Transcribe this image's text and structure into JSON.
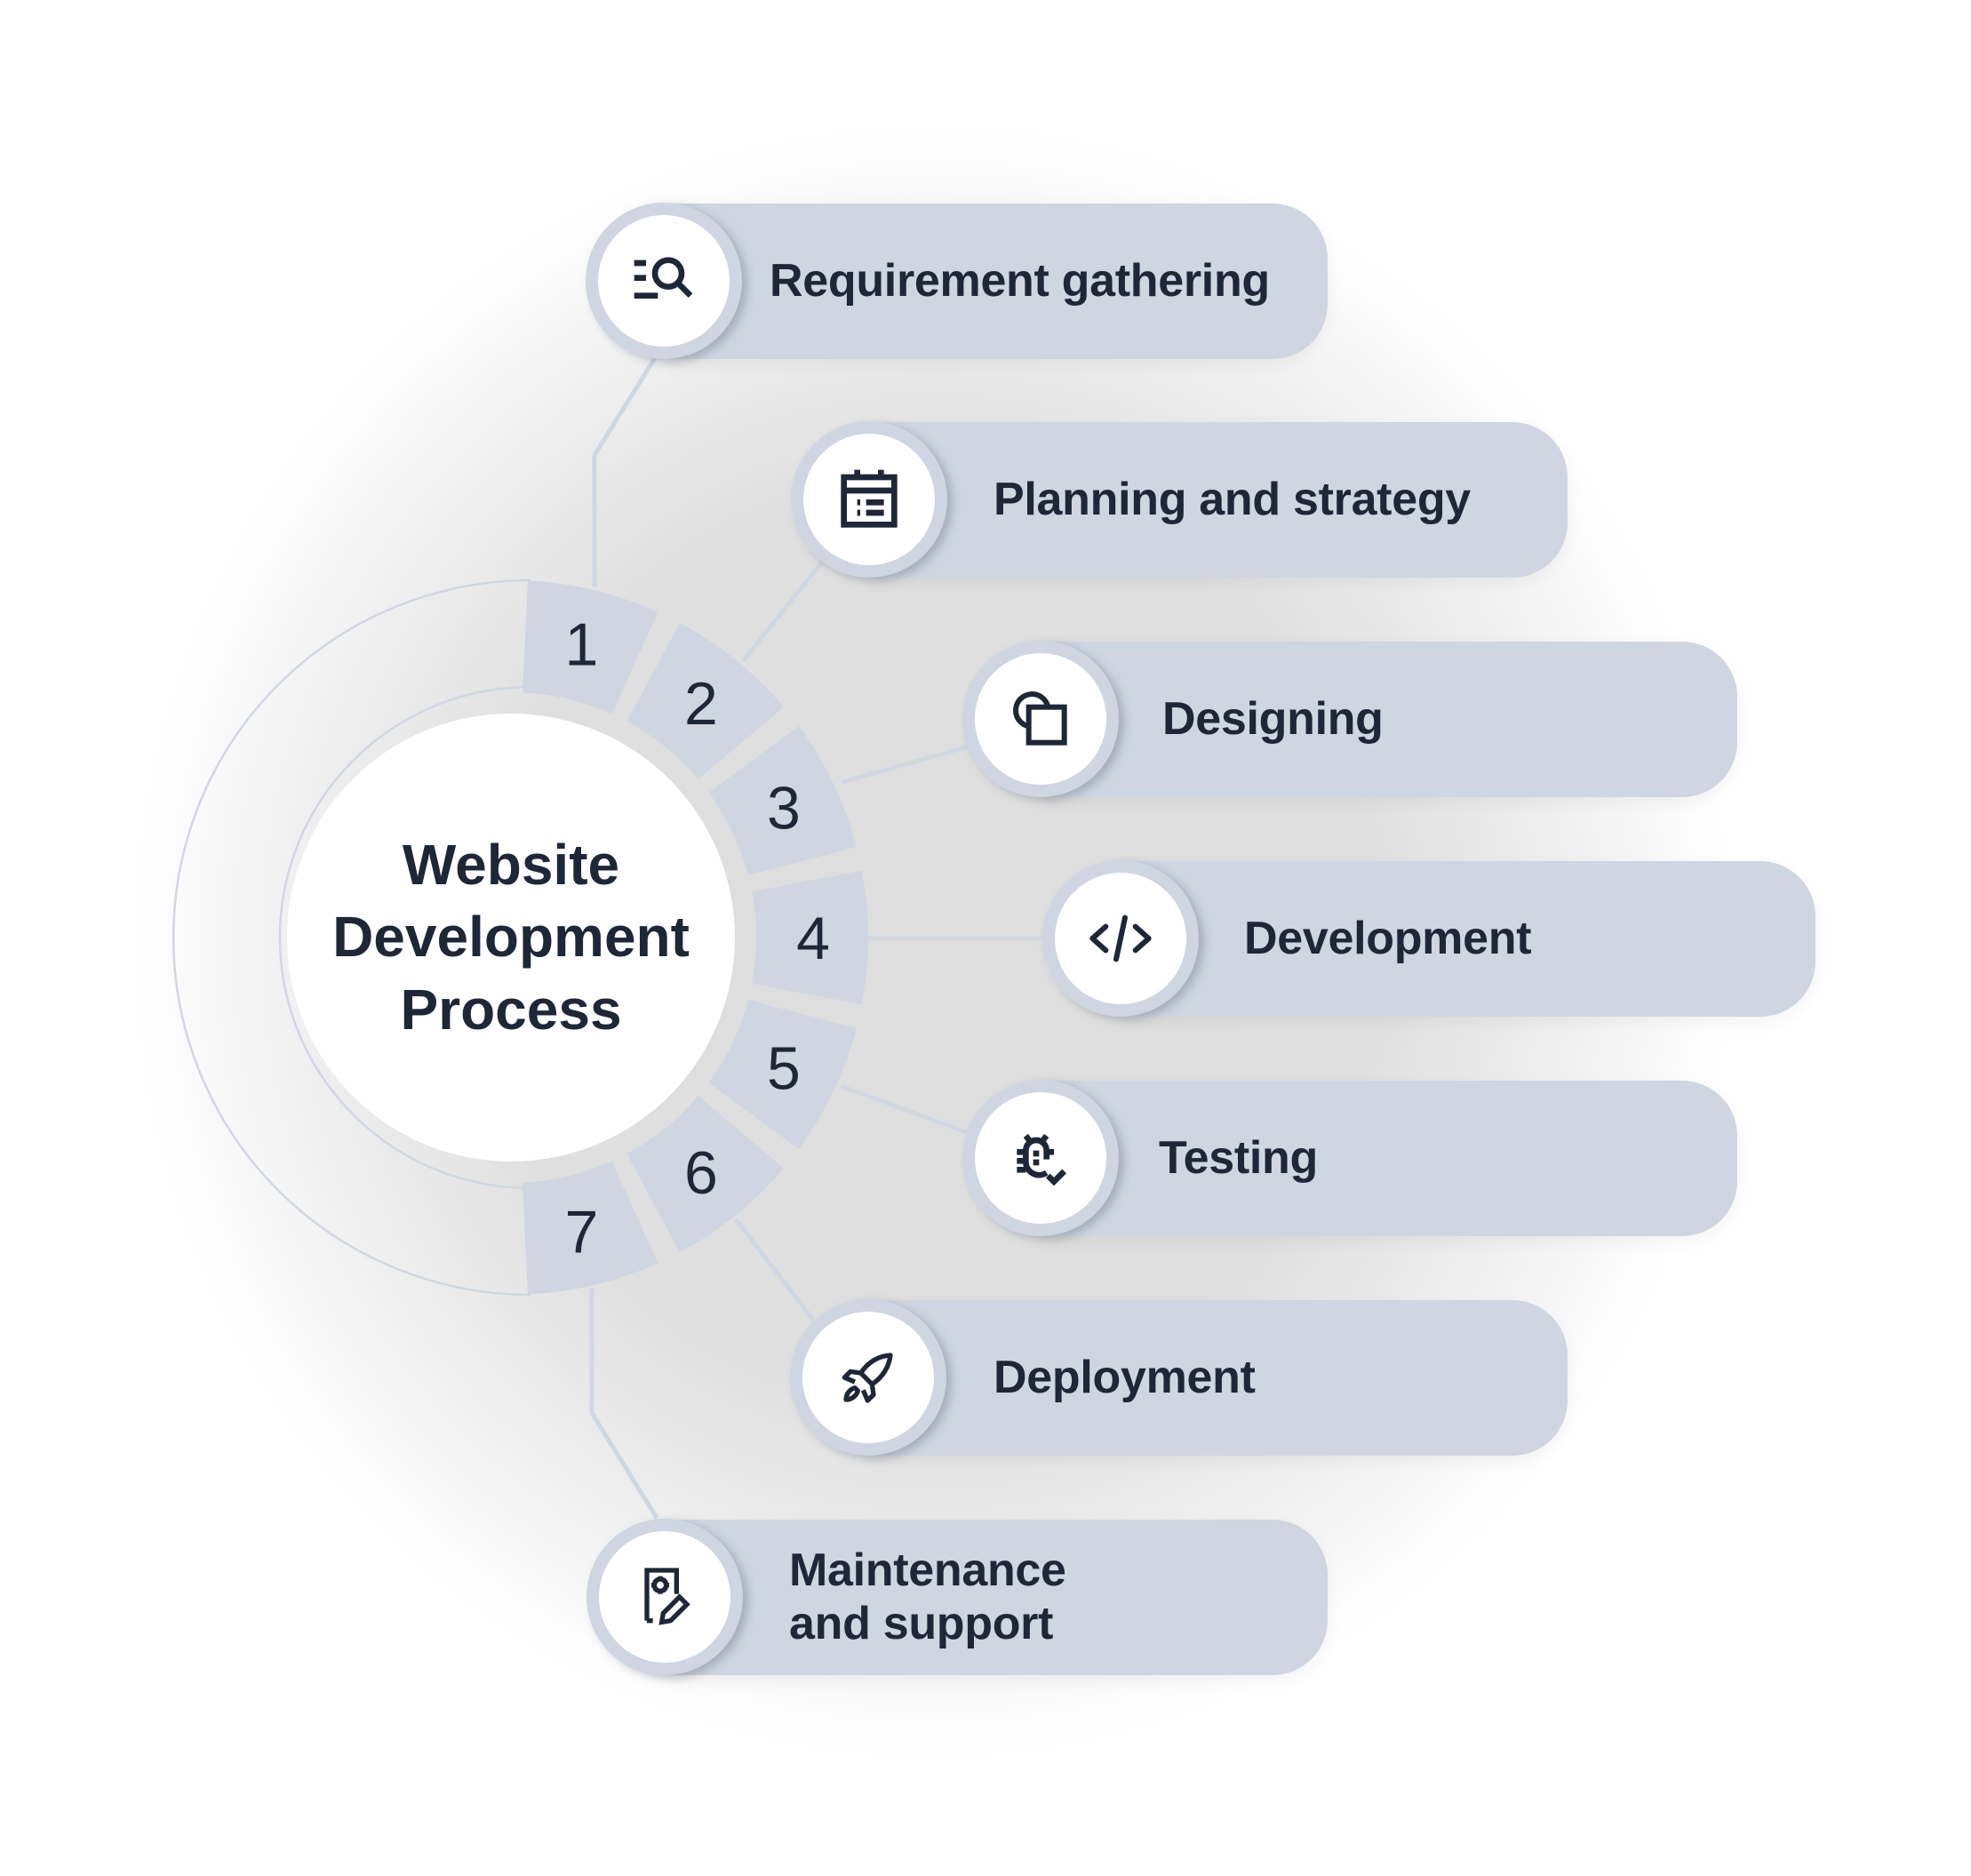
{
  "title": "Website\nDevelopment\nProcess",
  "title_lines": [
    "Website",
    "Development",
    "Process"
  ],
  "colors": {
    "pill": "#cfd6e2",
    "segment": "#cfd6e2",
    "connector": "#d0d7e3",
    "text": "#1e2738",
    "background_center": "#dfdfdf"
  },
  "steps": [
    {
      "number": "1",
      "label": "Requirement gathering",
      "icon": "list-search-icon"
    },
    {
      "number": "2",
      "label": "Planning and strategy",
      "icon": "calendar-list-icon"
    },
    {
      "number": "3",
      "label": "Designing",
      "icon": "shapes-icon"
    },
    {
      "number": "4",
      "label": "Development",
      "icon": "code-icon"
    },
    {
      "number": "5",
      "label": "Testing",
      "icon": "bug-check-icon"
    },
    {
      "number": "6",
      "label": "Deployment",
      "icon": "rocket-icon"
    },
    {
      "number": "7",
      "label": "Maintenance and support",
      "icon": "document-gear-edit-icon"
    }
  ]
}
